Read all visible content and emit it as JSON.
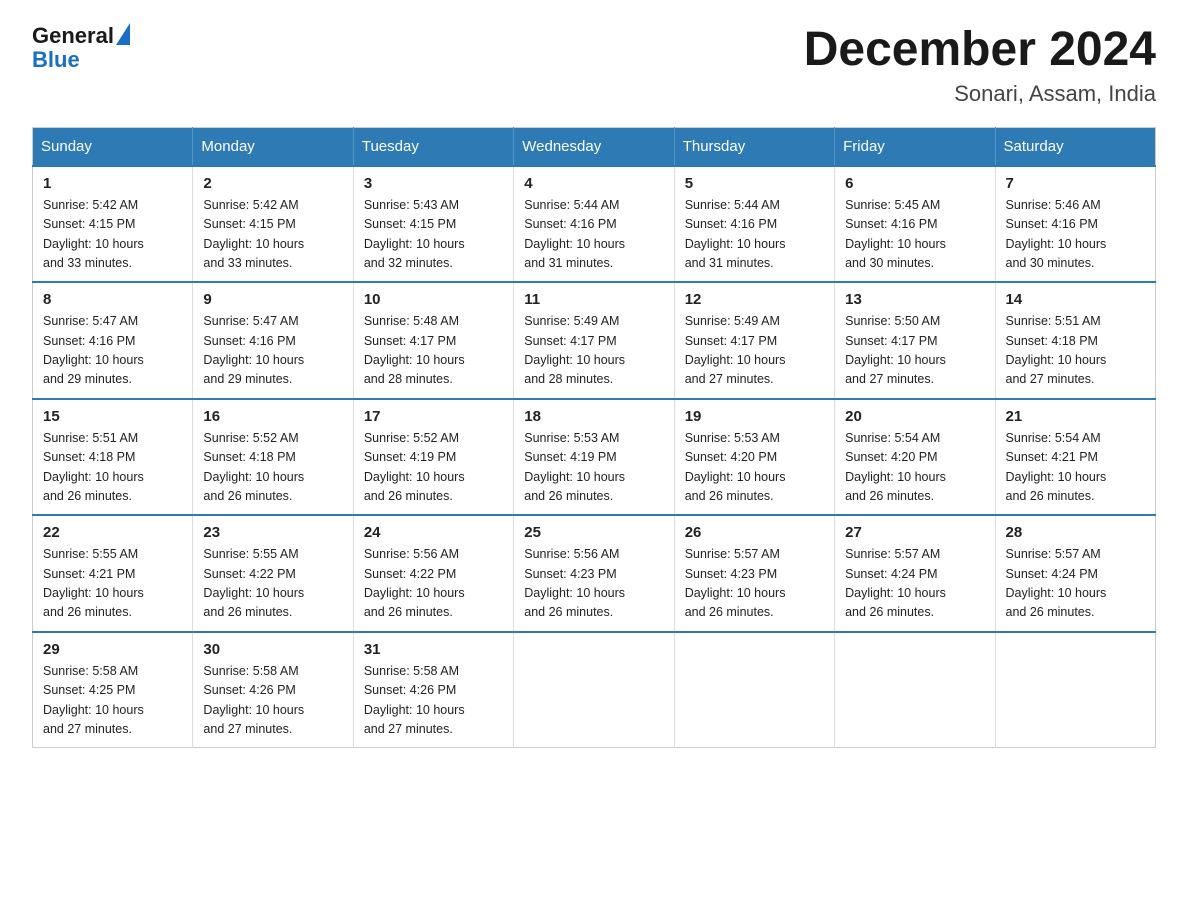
{
  "logo": {
    "text_general": "General",
    "text_blue": "Blue"
  },
  "title": "December 2024",
  "subtitle": "Sonari, Assam, India",
  "weekdays": [
    "Sunday",
    "Monday",
    "Tuesday",
    "Wednesday",
    "Thursday",
    "Friday",
    "Saturday"
  ],
  "weeks": [
    [
      {
        "day": "1",
        "sunrise": "5:42 AM",
        "sunset": "4:15 PM",
        "daylight": "10 hours and 33 minutes."
      },
      {
        "day": "2",
        "sunrise": "5:42 AM",
        "sunset": "4:15 PM",
        "daylight": "10 hours and 33 minutes."
      },
      {
        "day": "3",
        "sunrise": "5:43 AM",
        "sunset": "4:15 PM",
        "daylight": "10 hours and 32 minutes."
      },
      {
        "day": "4",
        "sunrise": "5:44 AM",
        "sunset": "4:16 PM",
        "daylight": "10 hours and 31 minutes."
      },
      {
        "day": "5",
        "sunrise": "5:44 AM",
        "sunset": "4:16 PM",
        "daylight": "10 hours and 31 minutes."
      },
      {
        "day": "6",
        "sunrise": "5:45 AM",
        "sunset": "4:16 PM",
        "daylight": "10 hours and 30 minutes."
      },
      {
        "day": "7",
        "sunrise": "5:46 AM",
        "sunset": "4:16 PM",
        "daylight": "10 hours and 30 minutes."
      }
    ],
    [
      {
        "day": "8",
        "sunrise": "5:47 AM",
        "sunset": "4:16 PM",
        "daylight": "10 hours and 29 minutes."
      },
      {
        "day": "9",
        "sunrise": "5:47 AM",
        "sunset": "4:16 PM",
        "daylight": "10 hours and 29 minutes."
      },
      {
        "day": "10",
        "sunrise": "5:48 AM",
        "sunset": "4:17 PM",
        "daylight": "10 hours and 28 minutes."
      },
      {
        "day": "11",
        "sunrise": "5:49 AM",
        "sunset": "4:17 PM",
        "daylight": "10 hours and 28 minutes."
      },
      {
        "day": "12",
        "sunrise": "5:49 AM",
        "sunset": "4:17 PM",
        "daylight": "10 hours and 27 minutes."
      },
      {
        "day": "13",
        "sunrise": "5:50 AM",
        "sunset": "4:17 PM",
        "daylight": "10 hours and 27 minutes."
      },
      {
        "day": "14",
        "sunrise": "5:51 AM",
        "sunset": "4:18 PM",
        "daylight": "10 hours and 27 minutes."
      }
    ],
    [
      {
        "day": "15",
        "sunrise": "5:51 AM",
        "sunset": "4:18 PM",
        "daylight": "10 hours and 26 minutes."
      },
      {
        "day": "16",
        "sunrise": "5:52 AM",
        "sunset": "4:18 PM",
        "daylight": "10 hours and 26 minutes."
      },
      {
        "day": "17",
        "sunrise": "5:52 AM",
        "sunset": "4:19 PM",
        "daylight": "10 hours and 26 minutes."
      },
      {
        "day": "18",
        "sunrise": "5:53 AM",
        "sunset": "4:19 PM",
        "daylight": "10 hours and 26 minutes."
      },
      {
        "day": "19",
        "sunrise": "5:53 AM",
        "sunset": "4:20 PM",
        "daylight": "10 hours and 26 minutes."
      },
      {
        "day": "20",
        "sunrise": "5:54 AM",
        "sunset": "4:20 PM",
        "daylight": "10 hours and 26 minutes."
      },
      {
        "day": "21",
        "sunrise": "5:54 AM",
        "sunset": "4:21 PM",
        "daylight": "10 hours and 26 minutes."
      }
    ],
    [
      {
        "day": "22",
        "sunrise": "5:55 AM",
        "sunset": "4:21 PM",
        "daylight": "10 hours and 26 minutes."
      },
      {
        "day": "23",
        "sunrise": "5:55 AM",
        "sunset": "4:22 PM",
        "daylight": "10 hours and 26 minutes."
      },
      {
        "day": "24",
        "sunrise": "5:56 AM",
        "sunset": "4:22 PM",
        "daylight": "10 hours and 26 minutes."
      },
      {
        "day": "25",
        "sunrise": "5:56 AM",
        "sunset": "4:23 PM",
        "daylight": "10 hours and 26 minutes."
      },
      {
        "day": "26",
        "sunrise": "5:57 AM",
        "sunset": "4:23 PM",
        "daylight": "10 hours and 26 minutes."
      },
      {
        "day": "27",
        "sunrise": "5:57 AM",
        "sunset": "4:24 PM",
        "daylight": "10 hours and 26 minutes."
      },
      {
        "day": "28",
        "sunrise": "5:57 AM",
        "sunset": "4:24 PM",
        "daylight": "10 hours and 26 minutes."
      }
    ],
    [
      {
        "day": "29",
        "sunrise": "5:58 AM",
        "sunset": "4:25 PM",
        "daylight": "10 hours and 27 minutes."
      },
      {
        "day": "30",
        "sunrise": "5:58 AM",
        "sunset": "4:26 PM",
        "daylight": "10 hours and 27 minutes."
      },
      {
        "day": "31",
        "sunrise": "5:58 AM",
        "sunset": "4:26 PM",
        "daylight": "10 hours and 27 minutes."
      },
      null,
      null,
      null,
      null
    ]
  ]
}
